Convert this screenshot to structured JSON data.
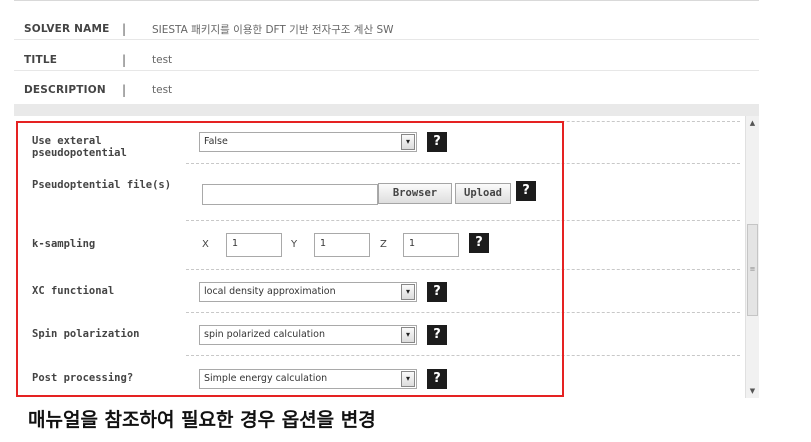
{
  "info": {
    "solver_name_label": "SOLVER NAME",
    "solver_name_value": "SIESTA 패키지를 이용한 DFT 기반 전자구조 계산 SW",
    "title_label": "TITLE",
    "title_value": "test",
    "description_label": "DESCRIPTION",
    "description_value": "test",
    "separator": "|"
  },
  "form": {
    "pseudo": {
      "label_line1": "Use exteral",
      "label_line2": "pseudopotential",
      "value": "False"
    },
    "pseudo_file": {
      "label": "Pseudoptential file(s)",
      "value": "",
      "browse_label": "Browser",
      "upload_label": "Upload"
    },
    "ksampling": {
      "label": "k-sampling",
      "x_label": "X",
      "x_value": "1",
      "y_label": "Y",
      "y_value": "1",
      "z_label": "Z",
      "z_value": "1"
    },
    "xc": {
      "label": "XC functional",
      "value": "local density approximation"
    },
    "spin": {
      "label": "Spin polarization",
      "value": "spin polarized calculation"
    },
    "post": {
      "label": "Post processing?",
      "value": "Simple energy calculation"
    },
    "help_glyph": "?",
    "dropdown_glyph": "▾"
  },
  "scrollbar": {
    "up_glyph": "▲",
    "down_glyph": "▼",
    "grip_glyph": "≡",
    "position_fraction": 0.5
  },
  "caption": "매뉴얼을 참조하여 필요한 경우 옵션을 변경",
  "colors": {
    "highlight_border": "#e52222",
    "help_button_bg": "#1c1c1c"
  }
}
